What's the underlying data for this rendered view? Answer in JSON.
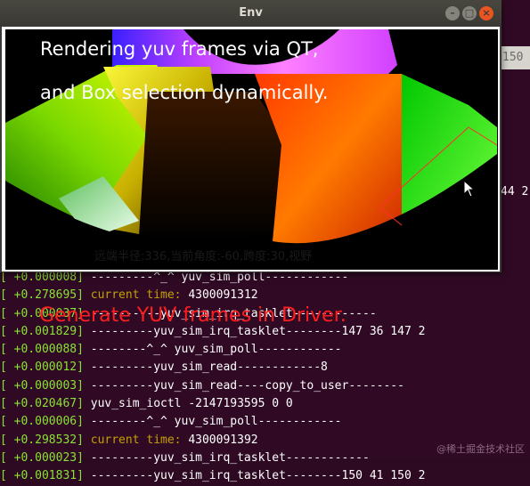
{
  "window": {
    "title": "Env"
  },
  "overlay": {
    "line1": "Rendering yuv frames via QT,",
    "line2": "and Box selection dynamically."
  },
  "canvas_status": "远端半径:336,当前角度:-60,跨度:30,视野",
  "driver_label": "Generate YUV frames in Driver.",
  "terminal": {
    "tab_text": "150",
    "right_fragment": "44 2",
    "lines": [
      {
        "ts": " +0.000008]",
        "msg": "---------^_^ yuv_sim_poll------------",
        "hl": ""
      },
      {
        "ts": " +0.278695]",
        "msg": "",
        "hl": "current time:",
        "tail": " 4300091312"
      },
      {
        "ts": " +0.000037]",
        "msg": "----------yuv_sim_irq_tasklet------------",
        "hl": ""
      },
      {
        "ts": " +0.001829]",
        "msg": "---------yuv_sim_irq_tasklet--------147 36 147 2",
        "hl": ""
      },
      {
        "ts": " +0.000088]",
        "msg": "--------^_^ yuv_sim_poll------------",
        "hl": ""
      },
      {
        "ts": " +0.000012]",
        "msg": "---------yuv_sim_read------------8",
        "hl": ""
      },
      {
        "ts": " +0.000003]",
        "msg": "---------yuv_sim_read----copy_to_user--------",
        "hl": ""
      },
      {
        "ts": " +0.020467]",
        "msg": "yuv_sim_ioctl -2147193595 0 0",
        "hl": ""
      },
      {
        "ts": " +0.000006]",
        "msg": "--------^_^ yuv_sim_poll------------",
        "hl": ""
      },
      {
        "ts": " +0.298532]",
        "msg": "",
        "hl": "current time:",
        "tail": " 4300091392"
      },
      {
        "ts": " +0.000023]",
        "msg": "---------yuv_sim_irq_tasklet------------",
        "hl": ""
      },
      {
        "ts": " +0.001831]",
        "msg": "---------yuv_sim_irq_tasklet--------150 41 150 2",
        "hl": ""
      }
    ]
  },
  "watermark": "@稀土掘金技术社区"
}
